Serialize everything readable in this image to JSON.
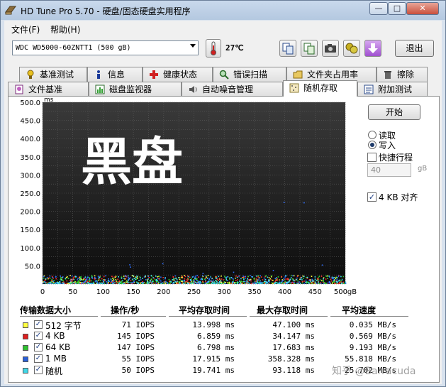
{
  "window": {
    "title": "HD Tune Pro 5.70 - 硬盘/固态硬盘实用程序",
    "minimize": "—",
    "maximize": "□",
    "close": "✕"
  },
  "menu": [
    "文件(F)",
    "帮助(H)"
  ],
  "toolbar": {
    "drive": "WDC WD5000-60ZNTT1 (500 gB)",
    "temperature": "27℃",
    "exit_label": "退出",
    "icons": [
      "copy-info-icon",
      "copy-all-icon",
      "screenshot-camera-icon",
      "health-icon",
      "save-download-icon"
    ]
  },
  "tabs_row1": [
    {
      "label": "基准测试",
      "icon": "benchmark-icon"
    },
    {
      "label": "信息",
      "icon": "info-icon"
    },
    {
      "label": "健康状态",
      "icon": "health-cross-icon"
    },
    {
      "label": "错误扫描",
      "icon": "error-scan-icon"
    },
    {
      "label": "文件夹占用率",
      "icon": "folder-icon"
    },
    {
      "label": "擦除",
      "icon": "erase-trash-icon"
    }
  ],
  "tabs_row2": [
    {
      "label": "文件基准",
      "icon": "file-benchmark-icon"
    },
    {
      "label": "磁盘监视器",
      "icon": "disk-monitor-icon"
    },
    {
      "label": "自动噪音管理",
      "icon": "noise-speaker-icon"
    },
    {
      "label": "随机存取",
      "icon": "random-access-icon",
      "active": true
    },
    {
      "label": "附加测试",
      "icon": "extra-tests-icon"
    }
  ],
  "controls": {
    "start_label": "开始",
    "read_label": "读取",
    "write_label": "写入",
    "selected_mode": "写入",
    "quick_stroke_label": "快捷行程",
    "quick_stroke_checked": false,
    "quick_stroke_value": "40",
    "quick_stroke_unit": "gB",
    "align_label": "4 KB 对齐",
    "align_checked": true
  },
  "overlay_text": "黑盘",
  "chart_data": {
    "type": "scatter",
    "y_unit": "ms",
    "x_unit": "gB",
    "ylim": [
      0,
      500
    ],
    "xlim": [
      0,
      500
    ],
    "y_ticks": [
      "500.0",
      "450.0",
      "400.0",
      "350.0",
      "300.0",
      "250.0",
      "200.0",
      "150.0",
      "100.0",
      "50.0"
    ],
    "x_ticks": [
      "0",
      "50",
      "100",
      "150",
      "200",
      "250",
      "300",
      "350",
      "400",
      "450",
      "500gB"
    ],
    "grid": true,
    "series": [
      {
        "name": "512 字节",
        "color": "#ffff40",
        "typical_ms_range": [
          0,
          47.1
        ]
      },
      {
        "name": "4 KB",
        "color": "#ff3030",
        "typical_ms_range": [
          0,
          34.1
        ]
      },
      {
        "name": "64 KB",
        "color": "#30d030",
        "typical_ms_range": [
          0,
          17.7
        ]
      },
      {
        "name": "1 MB",
        "color": "#3070ff",
        "typical_ms_range": [
          0,
          358.3
        ]
      },
      {
        "name": "随机",
        "color": "#40e0f0",
        "typical_ms_range": [
          0,
          93.1
        ]
      }
    ]
  },
  "table": {
    "headers": [
      "传输数据大小",
      "操作/秒",
      "平均存取时间",
      "最大存取时间",
      "平均速度"
    ],
    "rows": [
      {
        "name": "512 字节",
        "color": "#ffff40",
        "ops": "71 IOPS",
        "avg": "13.998 ms",
        "max": "47.100 ms",
        "speed": "0.035 MB/s"
      },
      {
        "name": "4 KB",
        "color": "#e02020",
        "ops": "145 IOPS",
        "avg": "6.859 ms",
        "max": "34.147 ms",
        "speed": "0.569 MB/s"
      },
      {
        "name": "64 KB",
        "color": "#30c030",
        "ops": "147 IOPS",
        "avg": "6.798 ms",
        "max": "17.683 ms",
        "speed": "9.193 MB/s"
      },
      {
        "name": "1 MB",
        "color": "#2a60d8",
        "ops": "55 IOPS",
        "avg": "17.915 ms",
        "max": "358.328 ms",
        "speed": "55.818 MB/s"
      },
      {
        "name": "随机",
        "color": "#40d8e8",
        "ops": "50 IOPS",
        "avg": "19.741 ms",
        "max": "93.118 ms",
        "speed": "25.702 MB/s"
      }
    ]
  },
  "watermark": "知乎 @Barracuda"
}
